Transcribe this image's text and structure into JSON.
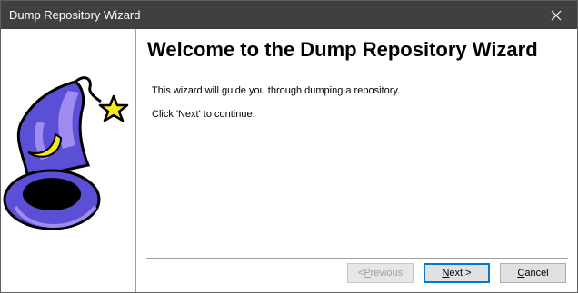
{
  "window": {
    "title": "Dump Repository Wizard",
    "close_glyph": "✕"
  },
  "left_pane": {
    "art_icon": "wizard-hat-icon",
    "colors": {
      "hat": "#5b4fd6",
      "hat_light": "#a08cf0",
      "star": "#f5e81c",
      "moon": "#f5e81c"
    }
  },
  "page": {
    "heading": "Welcome to the Dump Repository Wizard",
    "lines": [
      "This wizard will guide you through dumping a repository.",
      "Click 'Next' to continue."
    ]
  },
  "buttons": {
    "previous": {
      "prefix": "< ",
      "mnemonic": "P",
      "rest": "revious",
      "enabled": false
    },
    "next": {
      "mnemonic": "N",
      "rest": "ext >",
      "enabled": true,
      "default": true
    },
    "cancel": {
      "mnemonic": "C",
      "rest": "ancel",
      "enabled": true
    }
  },
  "colors": {
    "titlebar": "#404040",
    "default_button_border": "#0078d7"
  }
}
